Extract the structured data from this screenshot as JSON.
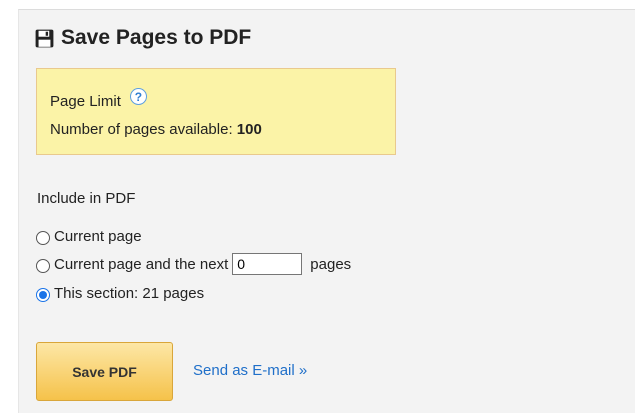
{
  "header": {
    "title": "Save Pages to PDF",
    "icon": "save-icon"
  },
  "limit": {
    "title": "Page Limit",
    "available_label": "Number of pages available:",
    "available_count": "100",
    "help_icon": "?"
  },
  "include": {
    "label": "Include in PDF",
    "options": [
      {
        "label": "Current page",
        "checked": false
      },
      {
        "label": "Current page and the next",
        "input_value": "0",
        "suffix": "pages",
        "checked": false
      },
      {
        "label": "This section: 21 pages",
        "checked": true
      }
    ]
  },
  "actions": {
    "save_label": "Save PDF",
    "email_label": "Send as E-mail »"
  },
  "colors": {
    "accent": "#1f6fc9",
    "limit_bg": "#fbf3a7",
    "button": "#f5c24a"
  }
}
